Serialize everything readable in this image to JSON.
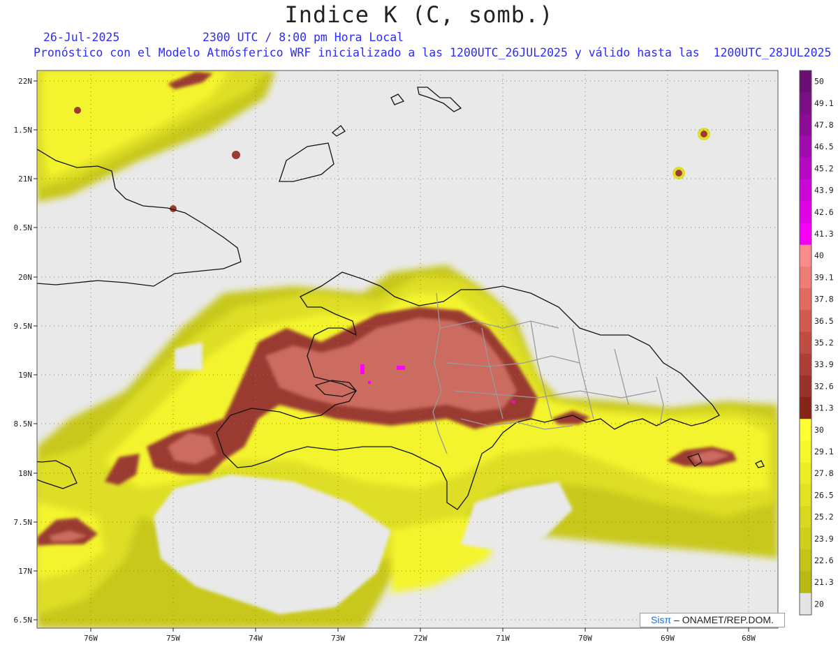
{
  "title": "Indice K (C, somb.)",
  "date": "26-Jul-2025",
  "time": "2300 UTC / 8:00 pm Hora Local",
  "subtitle": "Pronóstico con el Modelo Atmósferico WRF inicializado a las 1200UTC_26JUL2025 y válido hasta las  1200UTC_28JUL2025",
  "lat_labels": [
    "22N",
    "1.5N",
    "21N",
    "0.5N",
    "20N",
    "9.5N",
    "19N",
    "8.5N",
    "18N",
    "7.5N",
    "17N",
    "6.5N"
  ],
  "lon_labels": [
    "76W",
    "75W",
    "74W",
    "73W",
    "72W",
    "71W",
    "70W",
    "69W",
    "68W"
  ],
  "colorbar": {
    "labels": [
      "50",
      "49.1",
      "47.8",
      "46.5",
      "45.2",
      "43.9",
      "42.6",
      "41.3",
      "40",
      "39.1",
      "37.8",
      "36.5",
      "35.2",
      "33.9",
      "32.6",
      "31.3",
      "30",
      "29.1",
      "27.8",
      "26.5",
      "25.2",
      "23.9",
      "22.6",
      "21.3",
      "20"
    ],
    "colors": [
      "#6a0f72",
      "#7a0f84",
      "#8c0c97",
      "#a10aae",
      "#b708c3",
      "#cc06d6",
      "#e003e8",
      "#f400f8",
      "#ff8a8a",
      "#f07c76",
      "#e26a63",
      "#d35a52",
      "#c14c44",
      "#ae3f37",
      "#99322b",
      "#852619",
      "#ffff33",
      "#f6f62d",
      "#ecec27",
      "#e2e223",
      "#d8d81f",
      "#cece1c",
      "#c3c318",
      "#b9b914",
      "#e4e4e4"
    ]
  },
  "field_colors": {
    "background": "#e9e9e9",
    "k_low": "#c8c81a",
    "k_mid": "#dede26",
    "k_high": "#f4f42e",
    "k_very_high": "#ffff33",
    "k_brown": "#9a3a30",
    "k_salmon": "#cc6c60",
    "k_max": "#ff00ff",
    "coast": "#111111",
    "borders": "#9a9a9a"
  },
  "credit": {
    "sis": "Sisπ",
    "org": "– ONAMET/REP.DOM."
  }
}
